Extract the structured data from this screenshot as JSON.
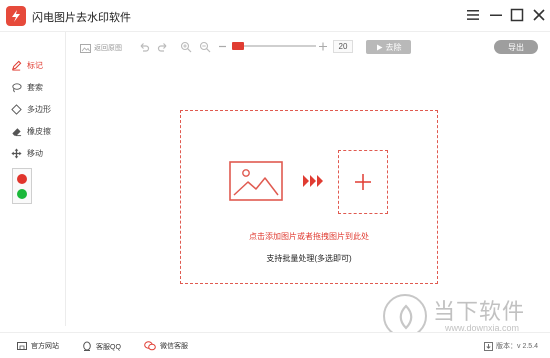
{
  "app": {
    "title": "闪电图片去水印软件"
  },
  "window": {
    "menu_icon": "hamburger-icon",
    "minimize_icon": "minimize-icon",
    "maximize_icon": "maximize-icon",
    "close_icon": "close-icon"
  },
  "sidebar": {
    "tools": [
      {
        "label": "标记",
        "icon": "pencil-icon",
        "active": true
      },
      {
        "label": "套索",
        "icon": "lasso-icon",
        "active": false
      },
      {
        "label": "多边形",
        "icon": "polygon-icon",
        "active": false
      },
      {
        "label": "橡皮擦",
        "icon": "eraser-icon",
        "active": false
      },
      {
        "label": "移动",
        "icon": "move-icon",
        "active": false
      }
    ],
    "colors": [
      "#e0342b",
      "#1bb83a"
    ]
  },
  "toolbar": {
    "back_to_original": "返回原图",
    "zoom_value": "20",
    "remove_label": "去除",
    "export_label": "导出"
  },
  "dropzone": {
    "drop_text": "点击添加图片或者拖拽图片到此处",
    "batch_text": "支持批量处理(多选即可)"
  },
  "footer": {
    "website": "官方网站",
    "qq_support": "客服QQ",
    "wechat_support": "微信客服",
    "version": "版本：v 2.5.4"
  },
  "watermark": {
    "name": "当下软件园",
    "url": "www.downxia.com"
  },
  "colors": {
    "accent": "#e03c32",
    "remove_button": "#b9b9b9",
    "export_button": "#9e9e9e"
  }
}
